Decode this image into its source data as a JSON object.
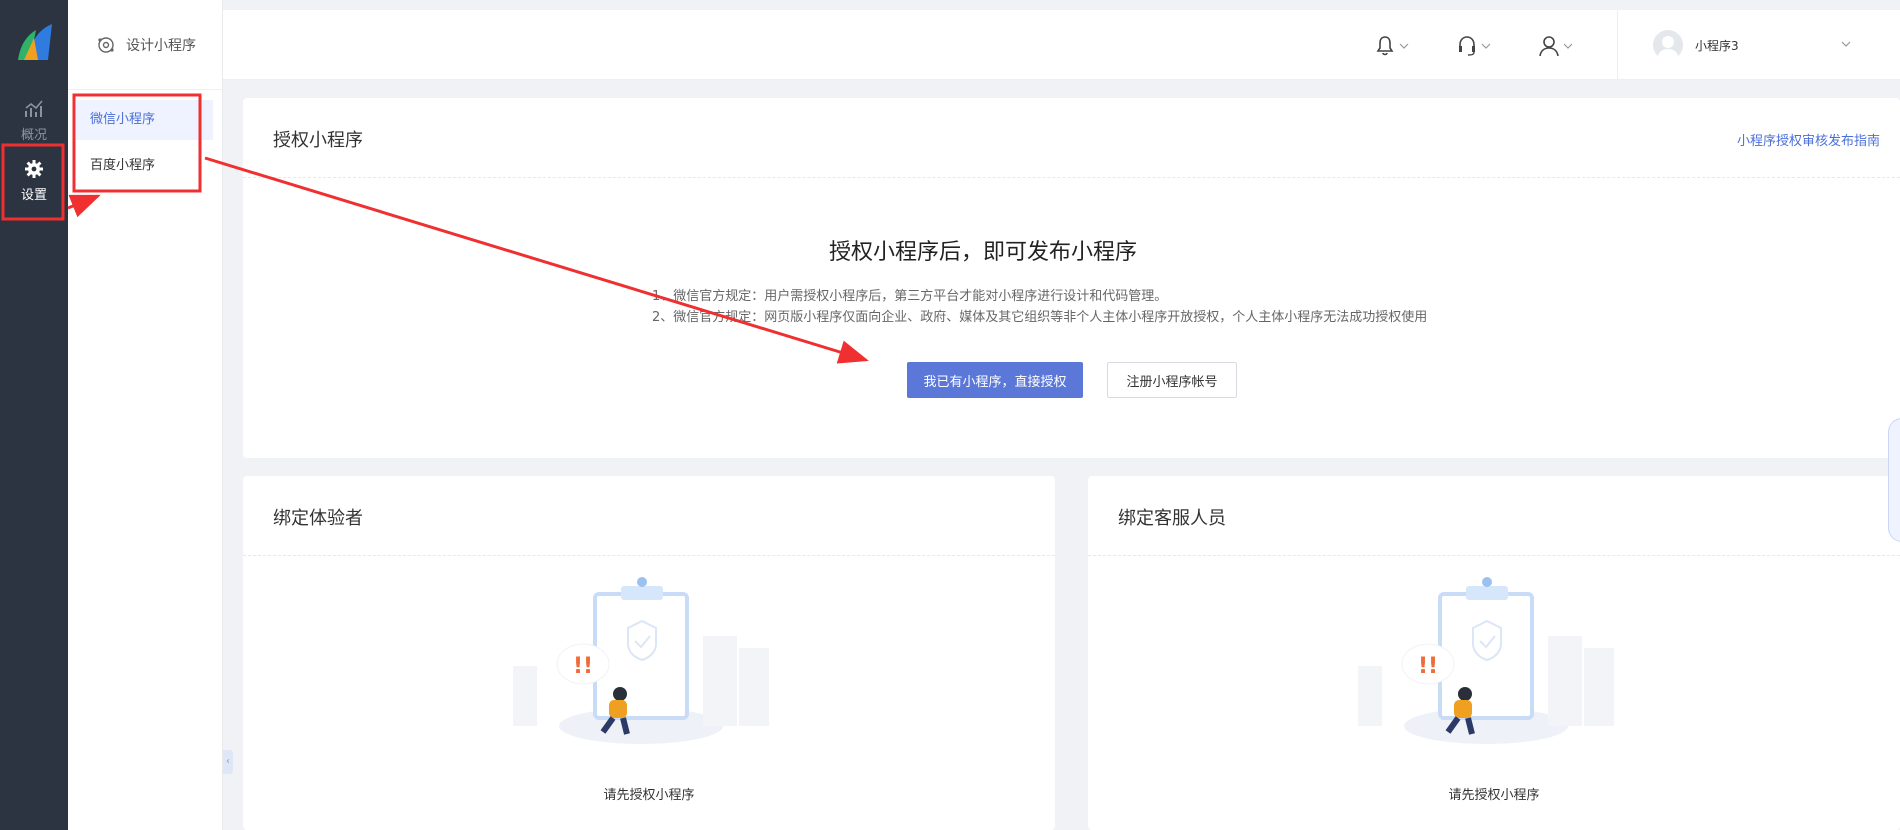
{
  "nav": {
    "overview_label": "概况",
    "settings_label": "设置"
  },
  "subnav": {
    "header": "设计小程序",
    "items": [
      {
        "label": "微信小程序",
        "active": true
      },
      {
        "label": "百度小程序",
        "active": false
      }
    ]
  },
  "account": {
    "name": "小程序3"
  },
  "auth_card": {
    "title": "授权小程序",
    "guide_link": "小程序授权审核发布指南",
    "headline": "授权小程序后，即可发布小程序",
    "rule_1": "1、微信官方规定：用户需授权小程序后，第三方平台才能对小程序进行设计和代码管理。",
    "rule_2": "2、微信官方规定：网页版小程序仅面向企业、政府、媒体及其它组织等非个人主体小程序开放授权，个人主体小程序无法成功授权使用",
    "primary_button": "我已有小程序，直接授权",
    "secondary_button": "注册小程序帐号"
  },
  "bind_tester_card": {
    "title": "绑定体验者",
    "empty_text": "请先授权小程序"
  },
  "bind_service_card": {
    "title": "绑定客服人员",
    "empty_text": "请先授权小程序"
  },
  "colors": {
    "rail_bg": "#2b3440",
    "accent": "#5b78d8",
    "link": "#4b6fd8",
    "annotation": "#f03030"
  },
  "icons": [
    "logo-icon",
    "chart-icon",
    "gear-icon",
    "design-icon",
    "bell-icon",
    "headset-icon",
    "user-icon",
    "chevron-down-icon",
    "avatar-icon",
    "clipboard-illustration"
  ]
}
